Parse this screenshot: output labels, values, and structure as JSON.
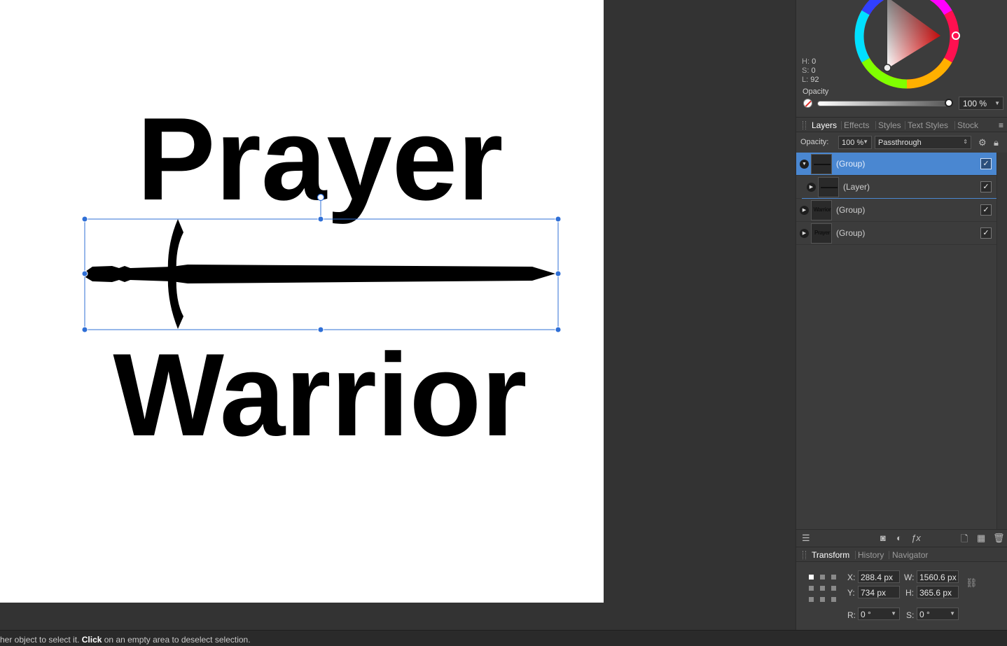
{
  "canvas": {
    "text_top": "Prayer",
    "text_bottom": "Warrior"
  },
  "color_panel": {
    "h_label": "H:",
    "h_value": "0",
    "s_label": "S:",
    "s_value": "0",
    "l_label": "L:",
    "l_value": "92",
    "opacity_label": "Opacity",
    "opacity_value": 1.0,
    "opacity_display": "100 %"
  },
  "layers_tabs": [
    "Layers",
    "Effects",
    "Styles",
    "Text Styles",
    "Stock"
  ],
  "layer_options": {
    "opacity_label": "Opacity:",
    "opacity_value": "100 %",
    "blend_mode": "Passthrough"
  },
  "layers": [
    {
      "name": "(Group)",
      "thumb_text": "",
      "selected": true,
      "expanded": true,
      "visible": "✓"
    },
    {
      "name": "(Layer)",
      "thumb_text": "",
      "selected": false,
      "expanded": false,
      "visible": "✓"
    },
    {
      "name": "(Group)",
      "thumb_text": "Warrior",
      "selected": false,
      "expanded": false,
      "visible": "✓"
    },
    {
      "name": "(Group)",
      "thumb_text": "Prayer",
      "selected": false,
      "expanded": false,
      "visible": "✓"
    }
  ],
  "bottom_tabs": [
    "Transform",
    "History",
    "Navigator"
  ],
  "transform": {
    "x_label": "X:",
    "x_value": "288.4 px",
    "y_label": "Y:",
    "y_value": "734 px",
    "w_label": "W:",
    "w_value": "1560.6 px",
    "h_label": "H:",
    "h_value": "365.6 px",
    "r_label": "R:",
    "r_value": "0 °",
    "s_label": "S:",
    "s_value": "0 °"
  },
  "status": {
    "prefix": "her object to select it. ",
    "bold": "Click",
    "suffix": " on an empty area to deselect selection."
  },
  "colors": {
    "selection_blue": "#4a87d1",
    "handle_blue": "#2f6fd6",
    "panel_bg": "#3c3c3c",
    "canvas_bg": "#333333"
  }
}
